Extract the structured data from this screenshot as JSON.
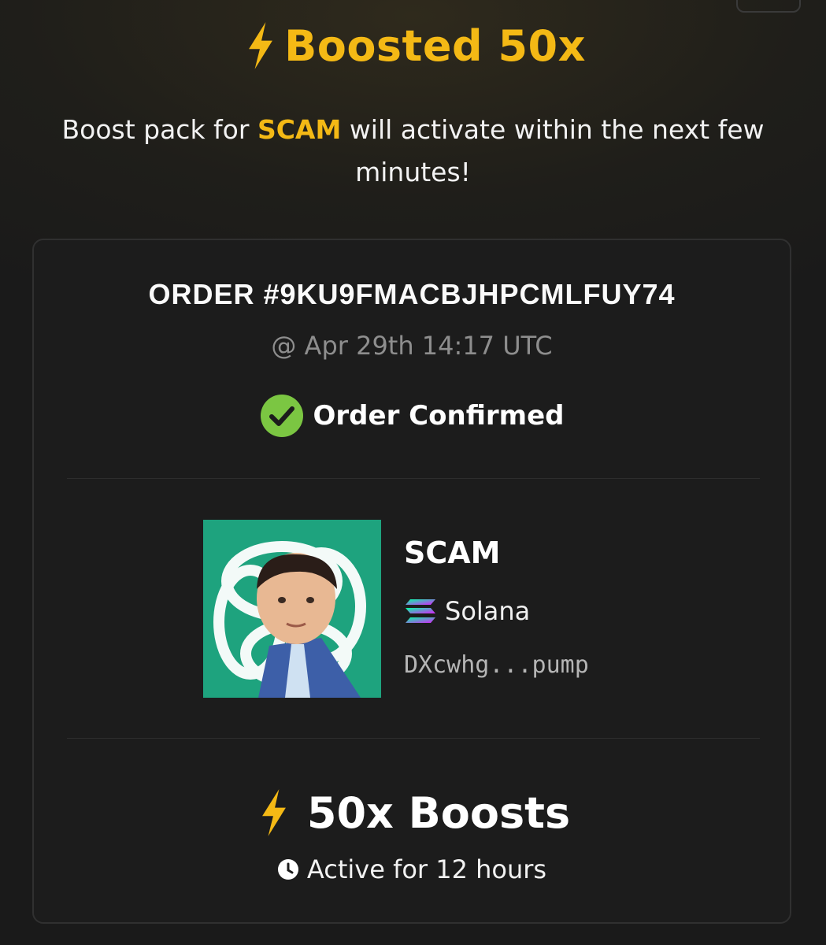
{
  "header": {
    "title": "Boosted 50x",
    "icon": "lightning-icon"
  },
  "message": {
    "prefix": "Boost pack for",
    "ticker": "SCAM",
    "suffix": "will activate within the next few minutes!"
  },
  "order": {
    "id": "ORDER #9KU9FMACBJHPCMLFUY74",
    "timestamp": "@ Apr 29th 14:17 UTC",
    "status": "Order Confirmed",
    "status_icon": "check-circle-icon"
  },
  "token": {
    "name": "SCAM",
    "chain": "Solana",
    "chain_icon": "solana-icon",
    "address": "DXcwhg...pump"
  },
  "boost": {
    "label": "50x Boosts",
    "duration": "Active for 12 hours",
    "duration_icon": "clock-icon"
  },
  "colors": {
    "accent": "#f4b915",
    "success": "#7bc642",
    "background": "#1c1c1c"
  }
}
